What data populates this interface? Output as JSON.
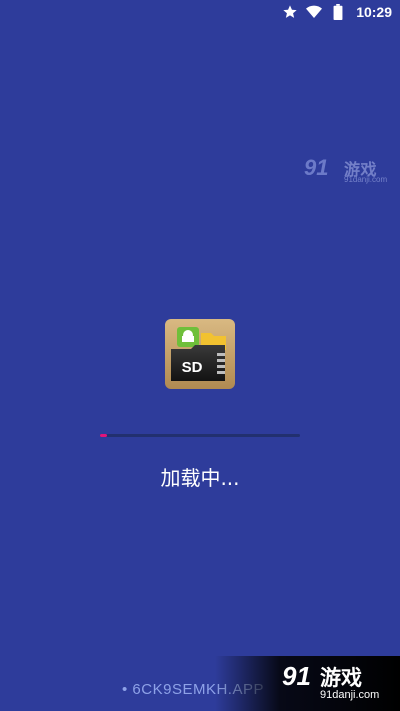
{
  "status_bar": {
    "time": "10:29",
    "icons": [
      "star-icon",
      "wifi-icon",
      "battery-icon"
    ]
  },
  "watermark_top": {
    "logo": "91",
    "text": "游戏",
    "url": "91danji.com"
  },
  "app": {
    "icon_text": "SD",
    "icon_name": "sd-card-folder-icon"
  },
  "progress": {
    "fraction": 0.035,
    "color": "#e1147a",
    "track_color": "#22306f"
  },
  "loading": {
    "text": "加载中..."
  },
  "bottom": {
    "code": "• 6CK9SEMKH.APP",
    "logo": "91",
    "text": "游戏",
    "url": "91danji.com"
  },
  "colors": {
    "background": "#2e3c9b",
    "text": "#ffffff"
  }
}
